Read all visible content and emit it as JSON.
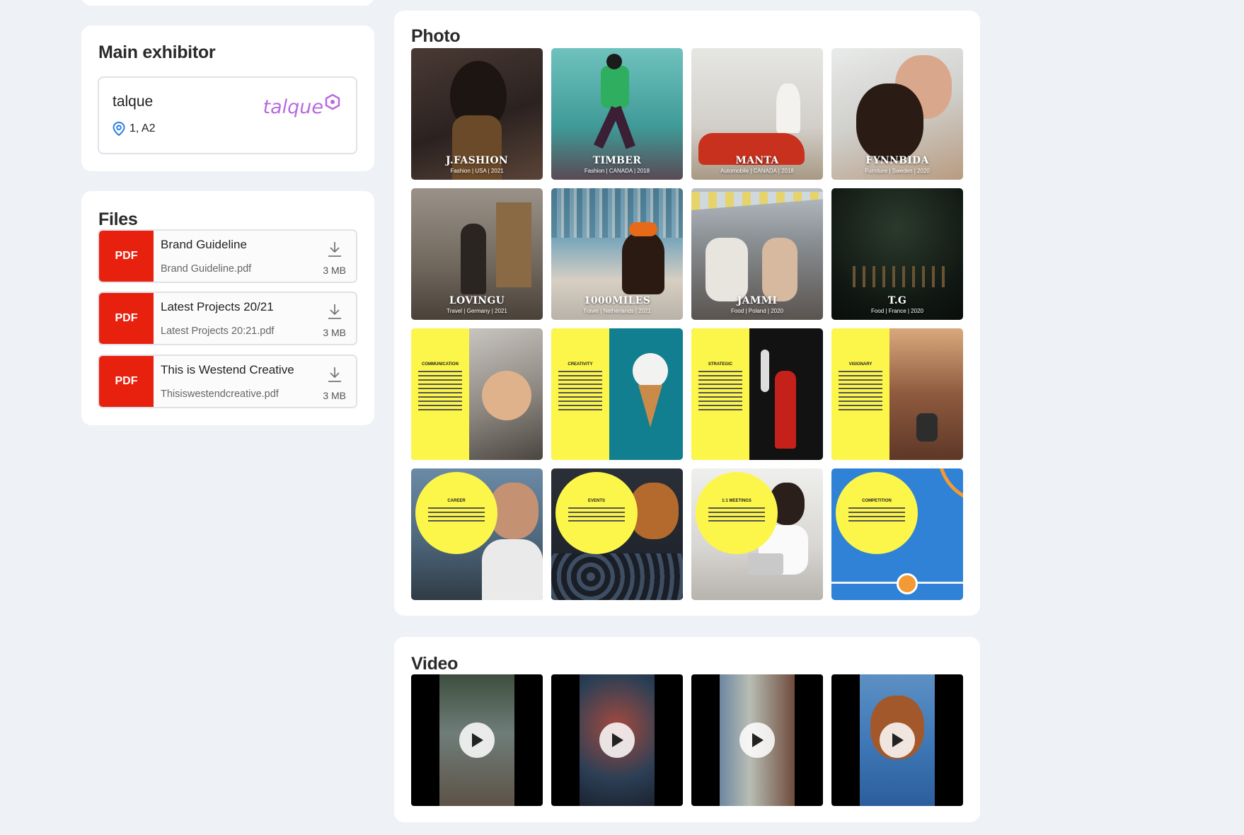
{
  "exhibitor": {
    "title": "Main exhibitor",
    "name": "talque",
    "location": "1, A2",
    "logo_text": "talque",
    "logo_color": "#b76be0"
  },
  "files": {
    "title": "Files",
    "items": [
      {
        "badge": "PDF",
        "name": "Brand Guideline",
        "filename": "Brand Guideline.pdf",
        "size": "3 MB"
      },
      {
        "badge": "PDF",
        "name": "Latest Projects 20/21",
        "filename": "Latest Projects 20:21.pdf",
        "size": "3 MB"
      },
      {
        "badge": "PDF",
        "name": "This is Westend Creative",
        "filename": "Thisiswestendcreative.pdf",
        "size": "3 MB"
      }
    ],
    "badge_color": "#e8210f"
  },
  "photo": {
    "title": "Photo",
    "tiles": [
      {
        "title": "J.FASHION",
        "sub": "Fashion | USA | 2021"
      },
      {
        "title": "TIMBER",
        "sub": "Fashion | CANADA | 2018"
      },
      {
        "title": "MANTA",
        "sub": "Automobile | CANADA | 2018"
      },
      {
        "title": "FYNNBIDA",
        "sub": "Furniture | Sweden | 2020"
      },
      {
        "title": "LOVINGU",
        "sub": "Travel | Germany | 2021"
      },
      {
        "title": "1000MILES",
        "sub": "Travel | Netherlands | 2021"
      },
      {
        "title": "JAMMI",
        "sub": "Food | Poland | 2020"
      },
      {
        "title": "T.G",
        "sub": "Food | France | 2020"
      }
    ],
    "panels": [
      "COMMUNICATION",
      "CREATIVITY",
      "STRATEGIC",
      "VISIONARY"
    ],
    "circles": [
      "CAREER",
      "EVENTS",
      "1:1 MEETINGS",
      "COMPETITION"
    ]
  },
  "video": {
    "title": "Video",
    "count": 4
  }
}
